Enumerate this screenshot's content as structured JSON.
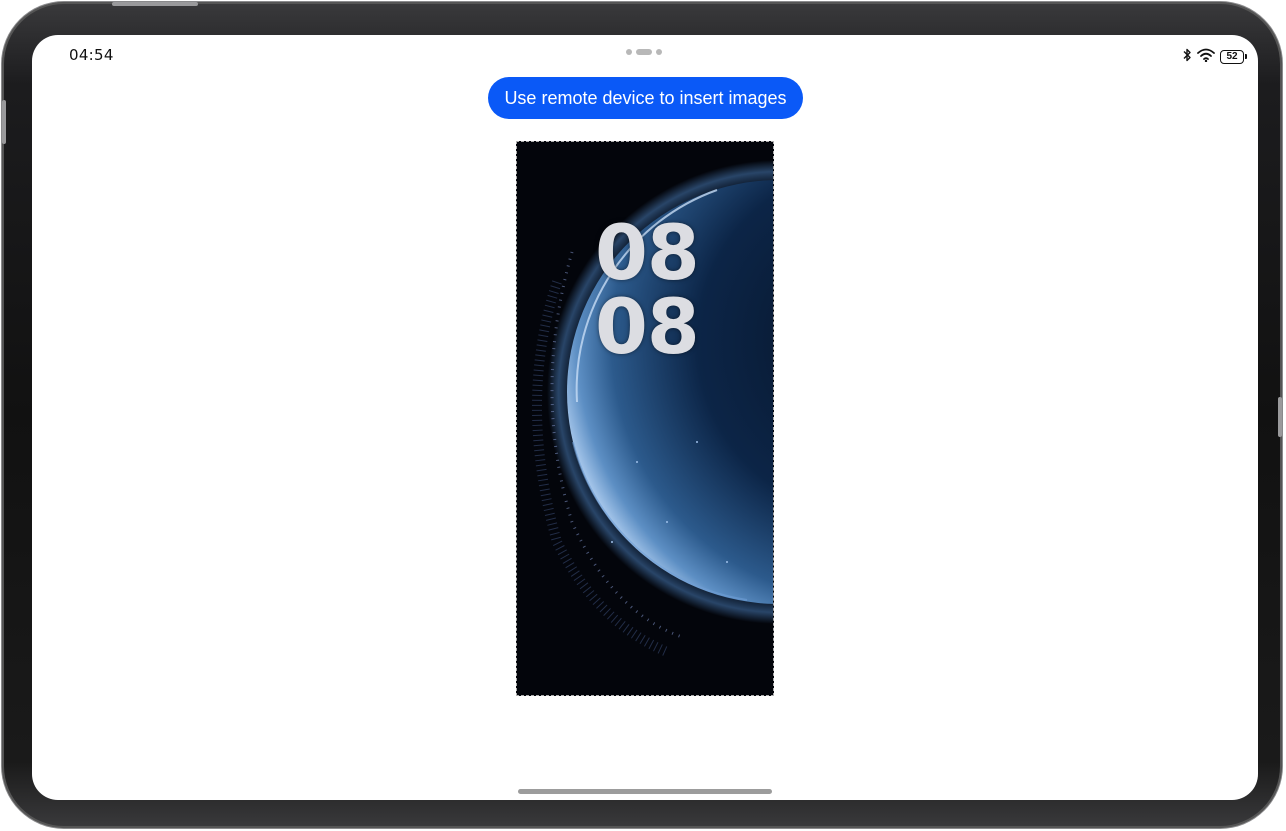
{
  "status_bar": {
    "time": "04:54",
    "battery_level": "52",
    "icons": [
      "bluetooth-icon",
      "wifi-icon",
      "battery-icon"
    ]
  },
  "main": {
    "insert_button_label": "Use remote device to insert images",
    "preview_image": {
      "clock_hours": "08",
      "clock_minutes": "08"
    }
  },
  "colors": {
    "accent": "#0a59f7",
    "wallpaper_background": "#03050b"
  }
}
